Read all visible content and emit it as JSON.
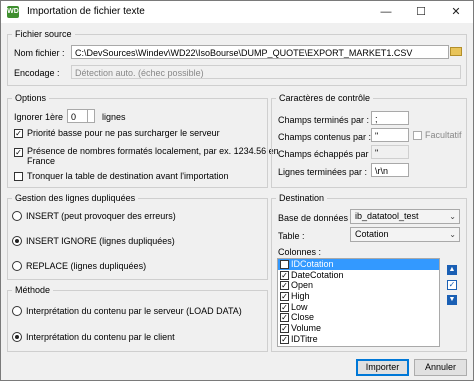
{
  "window": {
    "title": "Importation de fichier texte",
    "icon_text": "WD"
  },
  "source": {
    "legend": "Fichier source",
    "file_label": "Nom fichier :",
    "file_value": "C:\\DevSources\\Windev\\WD22\\IsoBourse\\DUMP_QUOTE\\EXPORT_MARKET1.CSV",
    "encoding_label": "Encodage :",
    "encoding_value": "Détection auto. (échec possible)"
  },
  "options": {
    "legend": "Options",
    "ignore_label": "Ignorer 1ère",
    "ignore_value": "0",
    "lines_label": "lignes",
    "opt1": "Priorité basse pour ne pas surcharger le serveur",
    "opt2a": "Présence de nombres formatés localement, par ex. 1234.56 en",
    "opt2b": "France",
    "opt3": "Tronquer la table de destination avant l'importation"
  },
  "control": {
    "legend": "Caractères de contrôle",
    "terminated_label": "Champs terminés par :",
    "terminated_value": ";",
    "enclosed_label": "Champs contenus par :",
    "enclosed_value": "\"",
    "optional_label": "Facultatif",
    "escaped_label": "Champs échappés par :",
    "escaped_value": "\"",
    "lines_label": "Lignes terminées par :",
    "lines_value": "\\r\\n"
  },
  "duplicates": {
    "legend": "Gestion des lignes dupliquées",
    "r1": "INSERT (peut provoquer des erreurs)",
    "r2": "INSERT IGNORE (lignes dupliquées)",
    "r3": "REPLACE (lignes dupliquées)"
  },
  "method": {
    "legend": "Méthode",
    "r1": "Interprétation du contenu par le serveur (LOAD DATA)",
    "r2": "Interprétation du contenu par le client"
  },
  "destination": {
    "legend": "Destination",
    "db_label": "Base de données :",
    "db_value": "ib_datatool_test",
    "table_label": "Table :",
    "table_value": "Cotation",
    "columns_label": "Colonnes :",
    "columns": [
      "IDCotation",
      "DateCotation",
      "Open",
      "High",
      "Low",
      "Close",
      "Volume",
      "IDTitre"
    ]
  },
  "buttons": {
    "import": "Importer",
    "cancel": "Annuler"
  }
}
